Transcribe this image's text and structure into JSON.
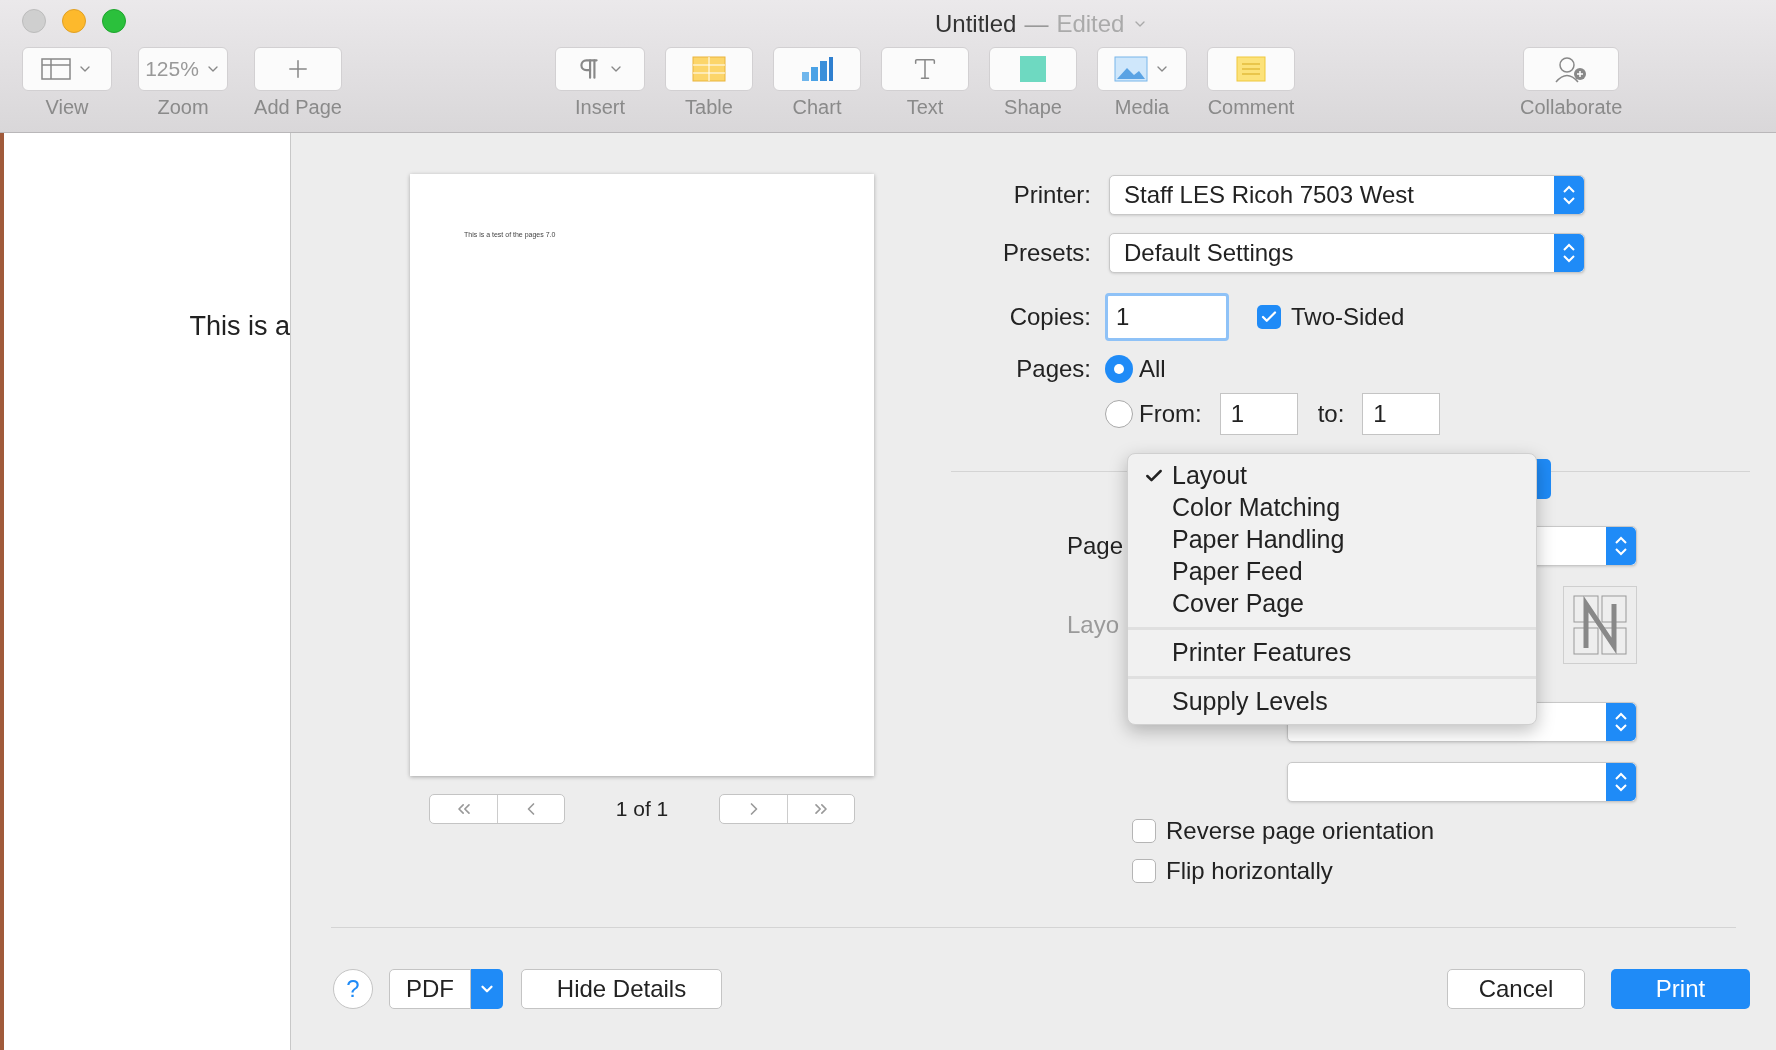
{
  "window": {
    "title": "Untitled",
    "separator": "—",
    "status": "Edited"
  },
  "toolbar": [
    {
      "kind": "view",
      "label": "View",
      "has_menu": true
    },
    {
      "kind": "zoom",
      "label": "Zoom",
      "value": "125%",
      "has_menu": true
    },
    {
      "kind": "add_page",
      "label": "Add Page",
      "has_menu": false
    },
    {
      "kind": "insert",
      "label": "Insert",
      "has_menu": true
    },
    {
      "kind": "table",
      "label": "Table",
      "has_menu": false
    },
    {
      "kind": "chart",
      "label": "Chart",
      "has_menu": false
    },
    {
      "kind": "text",
      "label": "Text",
      "has_menu": false
    },
    {
      "kind": "shape",
      "label": "Shape",
      "has_menu": false
    },
    {
      "kind": "media",
      "label": "Media",
      "has_menu": true
    },
    {
      "kind": "comment",
      "label": "Comment",
      "has_menu": false
    },
    {
      "kind": "collaborate",
      "label": "Collaborate",
      "has_menu": false
    }
  ],
  "document": {
    "text": "This is a"
  },
  "preview": {
    "page_text": "This is a test of the pages 7.0",
    "page_counter": "1 of 1"
  },
  "printer": {
    "label": "Printer:",
    "value": "Staff LES Ricoh 7503 West"
  },
  "presets": {
    "label": "Presets:",
    "value": "Default Settings"
  },
  "copies": {
    "label": "Copies:",
    "value": "1",
    "two_sided": {
      "label": "Two-Sided",
      "checked": true
    }
  },
  "pages": {
    "label": "Pages:",
    "options": [
      {
        "label": "All",
        "selected": true
      },
      {
        "label": "From:",
        "selected": false,
        "from": "1",
        "to_label": "to:",
        "to": "1"
      }
    ]
  },
  "layout_section": {
    "rows": [
      {
        "kind": "popup",
        "label": "Page",
        "disabled": false
      },
      {
        "kind": "direction",
        "label": "Layo",
        "disabled": true
      },
      {
        "kind": "popup",
        "disabled": false
      },
      {
        "kind": "popup",
        "disabled": false
      }
    ],
    "checkboxes": [
      {
        "label": "Reverse page orientation",
        "checked": false
      },
      {
        "label": "Flip horizontally",
        "checked": false
      }
    ]
  },
  "menu": {
    "groups": [
      [
        {
          "label": "Layout",
          "checked": true
        },
        {
          "label": "Color Matching",
          "checked": false
        },
        {
          "label": "Paper Handling",
          "checked": false
        },
        {
          "label": "Paper Feed",
          "checked": false
        },
        {
          "label": "Cover Page",
          "checked": false
        }
      ],
      [
        {
          "label": "Printer Features",
          "checked": false
        }
      ],
      [
        {
          "label": "Supply Levels",
          "checked": false
        }
      ]
    ]
  },
  "footer": {
    "help": "?",
    "pdf": "PDF",
    "hide_details": "Hide Details",
    "cancel": "Cancel",
    "print": {
      "label": "Print",
      "default": true
    }
  }
}
